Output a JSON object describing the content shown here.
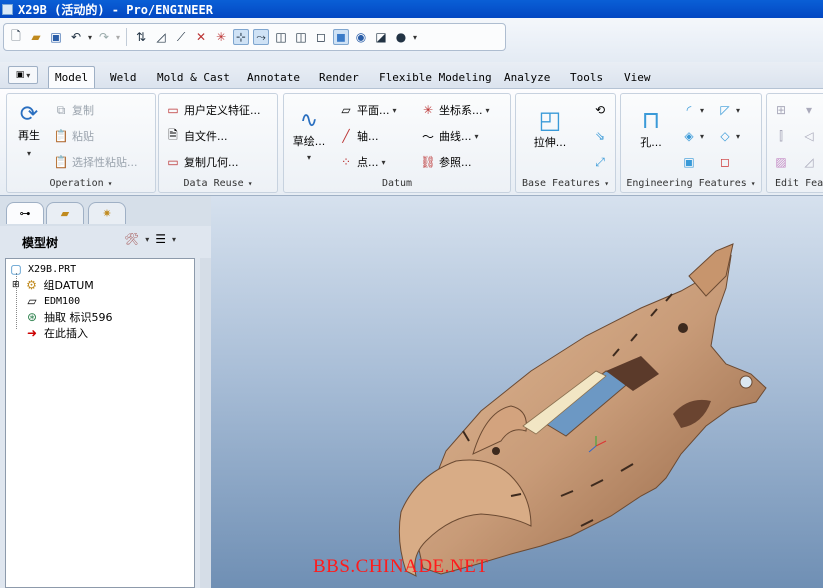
{
  "window": {
    "title": "X29B (活动的) - Pro/ENGINEER"
  },
  "quick_access": {
    "icons": [
      "new-file-icon",
      "open-folder-icon",
      "save-icon",
      "undo-icon",
      "redo-icon",
      "regenerate-icon",
      "datum-display-icon",
      "axis-display-icon",
      "point-display-icon",
      "csys-display-icon",
      "spin-center-icon",
      "annotation-display-icon",
      "wireframe-icon",
      "hidden-line-icon",
      "no-hidden-icon",
      "shading-icon",
      "saved-views-icon",
      "reorient-icon",
      "appearance-icon"
    ]
  },
  "tabs": [
    "Model",
    "Weld",
    "Mold & Cast",
    "Annotate",
    "Render",
    "Flexible Modeling",
    "Analyze",
    "Tools",
    "View"
  ],
  "active_tab": "Model",
  "groups": {
    "operation": {
      "label": "Operation",
      "regenerate": "再生",
      "copy": "复制",
      "paste": "粘贴",
      "paste_special": "选择性粘贴..."
    },
    "data_reuse": {
      "label": "Data Reuse",
      "udf": "用户定义特征...",
      "from_file": "自文件...",
      "copy_geom": "复制几何..."
    },
    "datum": {
      "label": "Datum",
      "sketch": "草绘...",
      "plane": "平面...",
      "axis": "轴...",
      "point": "点...",
      "csys": "坐标系...",
      "curve": "曲线...",
      "reference": "参照..."
    },
    "base_features": {
      "label": "Base Features",
      "extrude": "拉伸..."
    },
    "engineering_features": {
      "label": "Engineering Features",
      "hole": "孔..."
    },
    "edit_features": {
      "label": "Edit Fea"
    }
  },
  "navigator": {
    "title": "模型树",
    "items": [
      {
        "label": "X29B.PRT"
      },
      {
        "label": "组DATUM"
      },
      {
        "label": "EDM100"
      },
      {
        "label": "抽取 标识596"
      },
      {
        "label": "在此插入"
      }
    ]
  },
  "viewport": {
    "watermark": "BBS.CHINADE.NET",
    "model_color": "#c89b78"
  }
}
